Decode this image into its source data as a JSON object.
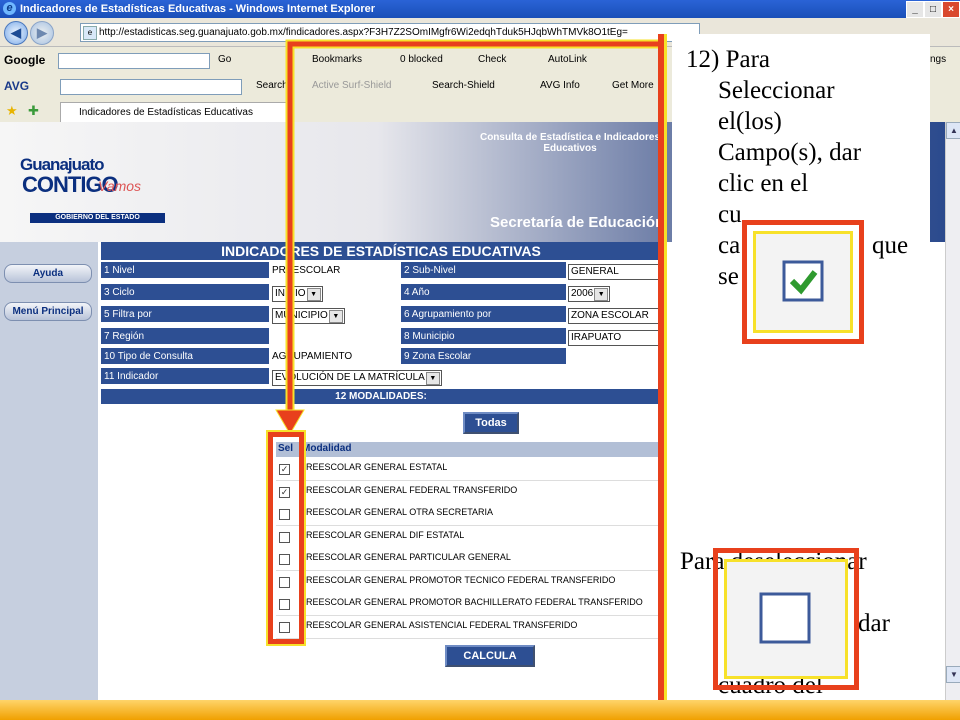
{
  "window": {
    "title": "Indicadores de Estadísticas Educativas - Windows Internet Explorer",
    "url": "http://estadisticas.seg.guanajuato.gob.mx/findicadores.aspx?F3H7Z2SOmIMgfr6Wi2edqhTduk5HJqbWhTMVk8O1tEg="
  },
  "toolbar": {
    "google": "Google",
    "go": "Go",
    "bookmarks": "Bookmarks",
    "blocked": "0 blocked",
    "check": "Check",
    "autolink": "AutoLink",
    "avg": "AVG",
    "search": "Search",
    "active_surf": "Active Surf-Shield",
    "search_shield": "Search-Shield",
    "avg_info": "AVG Info",
    "get_more": "Get More",
    "ngs": "ngs"
  },
  "tab": {
    "label": "Indicadores de Estadísticas Educativas"
  },
  "header": {
    "logo_top": "Guanajuato",
    "logo_main": "CONTIGO",
    "logo_script": "Vamos",
    "logo_gob": "GOBIERNO DEL ESTADO",
    "consulta": "Consulta de Estadística e Indicadores Educativos",
    "secretaria": "Secretaría de Educación"
  },
  "sidebar": {
    "ayuda": "Ayuda",
    "menu": "Menú Principal"
  },
  "form": {
    "title": "INDICADORES DE ESTADÍSTICAS EDUCATIVAS",
    "nivel_label": "1 Nivel",
    "nivel_value": "PREESCOLAR",
    "subnivel_label": "2 Sub-Nivel",
    "subnivel_value": "GENERAL",
    "ciclo_label": "3 Ciclo",
    "ciclo_value": "INICIO",
    "anio_label": "4 Año",
    "anio_value": "2006",
    "filtra_label": "5 Filtra por",
    "filtra_value": "MUNICIPIO",
    "agrup_label": "6 Agrupamiento por",
    "agrup_value": "ZONA ESCOLAR",
    "region_label": "7 Región",
    "municipio_label": "8 Municipio",
    "municipio_value": "IRAPUATO",
    "tipo_label": "10 Tipo de Consulta",
    "tipo_value": "AGRUPAMIENTO",
    "zona_label": "9 Zona Escolar",
    "indicador_label": "11 Indicador",
    "indicador_value": "EVOLUCIÓN DE LA MATRÍCULA",
    "modalidades_title": "12 MODALIDADES:",
    "todas": "Todas",
    "col_sel": "Sel",
    "col_modalidad": "Modalidad",
    "calcula": "CALCULA"
  },
  "modalidades": [
    {
      "label": "PREESCOLAR GENERAL ESTATAL",
      "checked": true
    },
    {
      "label": "PREESCOLAR GENERAL FEDERAL TRANSFERIDO",
      "checked": true
    },
    {
      "label": "PREESCOLAR GENERAL OTRA SECRETARIA",
      "checked": false
    },
    {
      "label": "PREESCOLAR GENERAL DIF ESTATAL",
      "checked": false
    },
    {
      "label": "PREESCOLAR GENERAL PARTICULAR GENERAL",
      "checked": false
    },
    {
      "label": "PREESCOLAR GENERAL PROMOTOR TECNICO FEDERAL TRANSFERIDO",
      "checked": false
    },
    {
      "label": "PREESCOLAR GENERAL PROMOTOR BACHILLERATO FEDERAL TRANSFERIDO",
      "checked": false
    },
    {
      "label": "PREESCOLAR GENERAL ASISTENCIAL FEDERAL TRANSFERIDO",
      "checked": false
    }
  ],
  "instructions": {
    "l1": "12) Para",
    "l2": "Seleccionar",
    "l3": "el(los)",
    "l4": "Campo(s), dar",
    "l5": "clic en el",
    "l6": "cu",
    "l7": "ca",
    "l7b": "que",
    "l8": "se",
    "second": "Para deseleccionar",
    "second_l3": "dar",
    "second_l5": "cuadro del"
  },
  "colors": {
    "accent": "#e8401c",
    "highlight": "#f7e12a",
    "form_blue": "#2d4f93"
  }
}
